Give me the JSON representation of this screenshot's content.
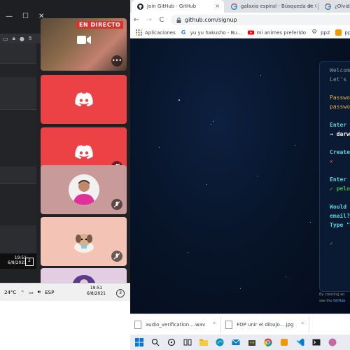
{
  "left_app": {
    "clock_time": "19:51",
    "clock_date": "6/8/2021",
    "notification_count": "2"
  },
  "call": {
    "live_badge": "EN DIRECTO",
    "more_label": "•••",
    "tiles": [
      {
        "kind": "video"
      },
      {
        "kind": "discord",
        "muted": false
      },
      {
        "kind": "discord",
        "muted": true
      },
      {
        "kind": "avatar-person",
        "muted": true
      },
      {
        "kind": "avatar-dog",
        "muted": true
      },
      {
        "kind": "avatar-partial"
      }
    ],
    "colors": {
      "discord_red": "#ed4245",
      "live_red": "#e0302a"
    }
  },
  "left_taskbar": {
    "temperature": "24°C",
    "language": "ESP",
    "time": "19:51",
    "date": "6/8/2021",
    "notifications": "3"
  },
  "browser": {
    "tabs": [
      {
        "title": "Join GitHub · GitHub",
        "icon": "github-icon",
        "active": true
      },
      {
        "title": "galaxia espiral - Búsqueda de Go",
        "icon": "google-icon",
        "active": false
      },
      {
        "title": "¿Olvidas",
        "icon": "google-icon",
        "active": false
      }
    ],
    "close_glyph": "×",
    "nav": {
      "back": "←",
      "forward": "→",
      "reload": "C"
    },
    "url": "github.com/signup",
    "bookmarks": [
      {
        "label": "Aplicaciones",
        "icon": "apps-grid-icon",
        "color": "#4285f4"
      },
      {
        "label": "yu yu hakusho - Bu...",
        "icon": "google-icon",
        "color": "#4285f4"
      },
      {
        "label": "mi animes preferido",
        "icon": "youtube-icon",
        "color": "#ff0000"
      },
      {
        "label": "pp2",
        "icon": "settings-icon",
        "color": "#5f6368"
      },
      {
        "label": "pp3",
        "icon": "app-icon",
        "color": "#f29900"
      },
      {
        "label": "Ve",
        "icon": "google-icon",
        "color": "#4285f4"
      }
    ]
  },
  "signup": {
    "lines": [
      {
        "text": "Welcom",
        "style": "t-gray"
      },
      {
        "text": "Let's",
        "style": "t-gray"
      },
      {
        "text": "",
        "style": "t-gray"
      },
      {
        "text": "Passwo",
        "style": "t-yellow"
      },
      {
        "text": "passwo",
        "style": "t-yellow"
      },
      {
        "text": "",
        "style": "t-gray"
      },
      {
        "text": "Enter",
        "style": "t-cyan"
      },
      {
        "text": "→ darw",
        "style": "t-white"
      },
      {
        "text": "",
        "style": "t-gray"
      },
      {
        "text": "Create",
        "style": "t-cyan"
      },
      {
        "text": "✕",
        "style": "t-red"
      },
      {
        "text": "",
        "style": "t-gray"
      },
      {
        "text": "Enter",
        "style": "t-cyan"
      },
      {
        "text": "✓ pelo",
        "style": "t-green"
      },
      {
        "text": "",
        "style": "t-gray"
      },
      {
        "text": "Would",
        "style": "t-cyan"
      },
      {
        "text": "email?",
        "style": "t-cyan"
      },
      {
        "text": "Type \"",
        "style": "t-cyan"
      },
      {
        "text": "",
        "style": "t-gray"
      },
      {
        "text": "✓",
        "style": "t-green"
      }
    ],
    "legal_line1": "By creating an",
    "legal_line2_prefix": "see the ",
    "legal_line2_link": "GitHub"
  },
  "downloads": [
    {
      "name": "audio_verification....wav",
      "chevron": "^"
    },
    {
      "name": "FDP unir el dibujo....jpg",
      "chevron": "^"
    }
  ],
  "taskbar": {
    "icons": [
      "windows-start-icon",
      "search-icon",
      "task-view-icon",
      "widgets-icon",
      "file-explorer-icon",
      "edge-icon",
      "mail-icon",
      "store-icon",
      "chrome-icon",
      "app-icon",
      "vscode-icon",
      "terminal-icon",
      "avatar-app-icon"
    ]
  }
}
